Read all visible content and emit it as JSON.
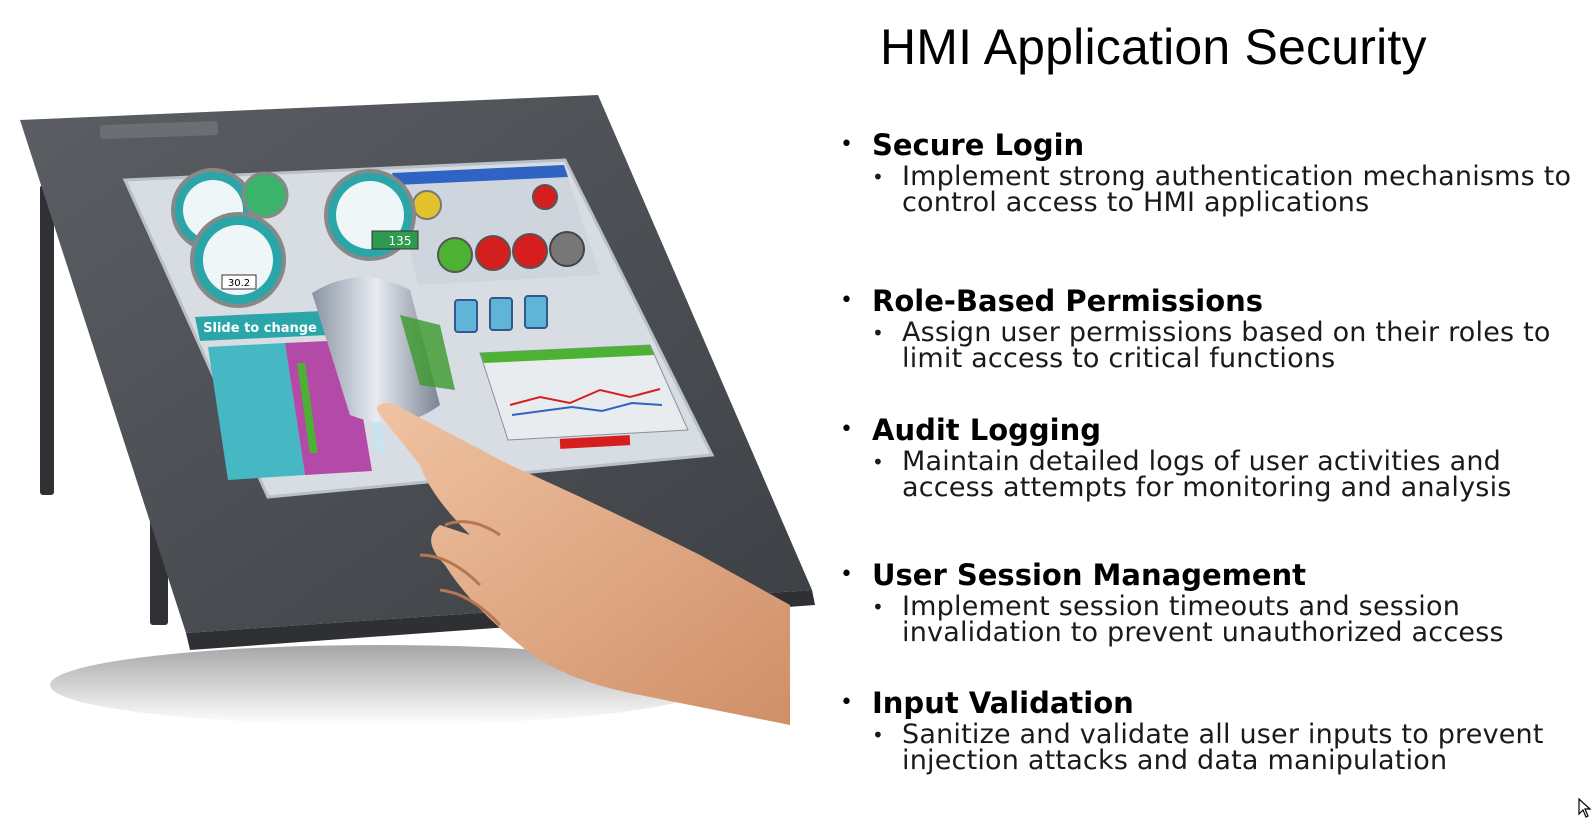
{
  "slide": {
    "title": "HMI Application Security",
    "items": [
      {
        "heading": "Secure Login",
        "detail": "Implement strong authentication mechanisms to control access to HMI applications"
      },
      {
        "heading": "Role-Based Permissions",
        "detail": "Assign user permissions based on their roles to limit access to critical functions"
      },
      {
        "heading": "Audit Logging",
        "detail": "Maintain detailed logs of user activities and access attempts for monitoring and analysis"
      },
      {
        "heading": "User Session Management",
        "detail": "Implement session timeouts and session invalidation to prevent unauthorized access"
      },
      {
        "heading": "Input Validation",
        "detail": "Sanitize and validate all user inputs to prevent injection attacks and data manipulation"
      }
    ]
  },
  "screen": {
    "slide_label": "Slide to change",
    "gauge_value_1": "135",
    "gauge_value_2": "30.2"
  },
  "colors": {
    "bezel": "#4a4d52",
    "screen_bg": "#d7dde3",
    "accent_blue": "#2f63c4",
    "indicator_red": "#d51f1f",
    "indicator_green": "#4db234",
    "skin": "#e6b18d"
  }
}
